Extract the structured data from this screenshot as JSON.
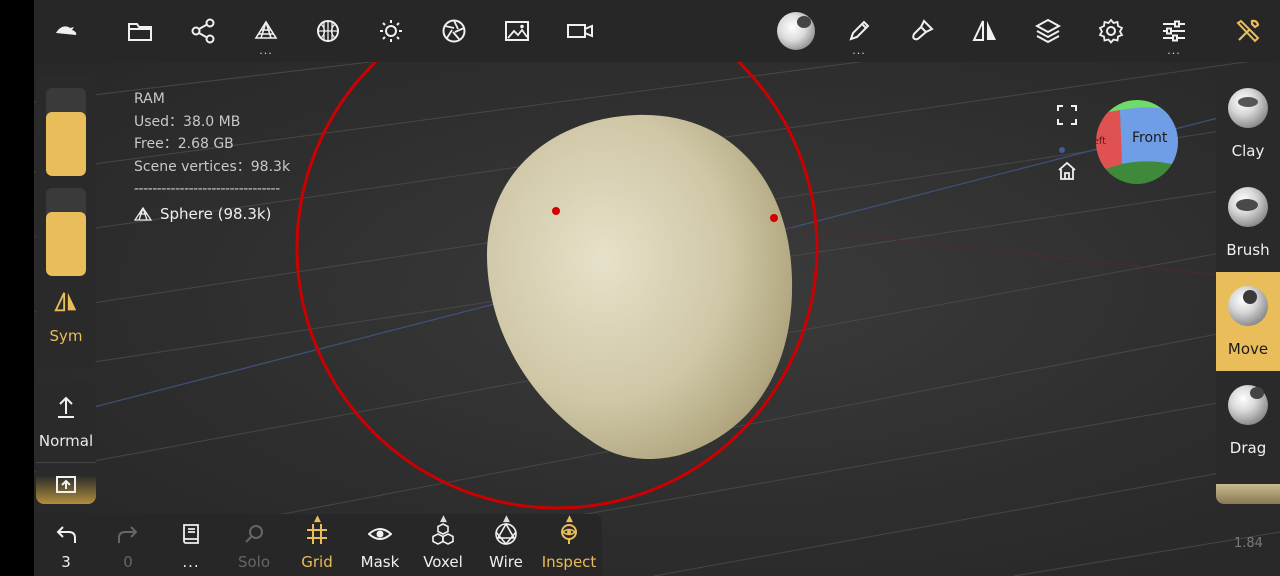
{
  "colors": {
    "accent": "#e9bd5a",
    "toolbar_bg": "#272727",
    "panel_bg": "#2a2a2a",
    "brush_ring": "#cc0000"
  },
  "top_toolbar": {
    "left_icons": [
      "nomad-logo-icon",
      "folder-icon",
      "scene-graph-icon",
      "mesh-icon",
      "material-sphere-icon",
      "light-icon",
      "camera-aperture-icon",
      "image-icon",
      "video-icon"
    ],
    "right_icons": [
      "material-ball-icon",
      "pen-icon",
      "paint-brush-icon",
      "symmetry-icon",
      "layers-icon",
      "settings-gear-icon",
      "sliders-icon",
      "tools-icon"
    ]
  },
  "left_panel": {
    "sym_label": "Sym",
    "radius_fill": 0.73,
    "intensity_fill": 0.73,
    "normal_label": "Normal"
  },
  "info": {
    "ram_label": "RAM",
    "used": "Used：38.0 MB",
    "free": "Free：2.68 GB",
    "vertices": "Scene vertices：98.3k",
    "separator": "--------------------------------",
    "object_name": "Sphere (98.3k)"
  },
  "gizmo": {
    "front_label": "Front",
    "left_label": "Left"
  },
  "tools": [
    {
      "name": "Clay",
      "active": false
    },
    {
      "name": "Brush",
      "active": false
    },
    {
      "name": "Move",
      "active": true
    },
    {
      "name": "Drag",
      "active": false
    }
  ],
  "bottom": {
    "undo_count": "3",
    "redo_count": "0",
    "buttons": [
      "Solo",
      "Grid",
      "Mask",
      "Voxel",
      "Wire",
      "Inspect"
    ]
  },
  "version": "1.84"
}
